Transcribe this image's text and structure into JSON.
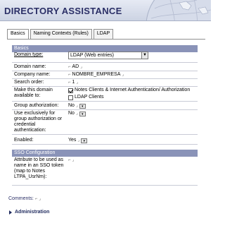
{
  "header": {
    "title": "DIRECTORY ASSISTANCE"
  },
  "tabs": [
    {
      "label": "Basics",
      "active": true
    },
    {
      "label": "Naming Contexts (Rules)",
      "active": false
    },
    {
      "label": "LDAP",
      "active": false
    }
  ],
  "basics": {
    "section_title": "Basics",
    "domain_type_label": "Domain type:",
    "domain_type_value": "LDAP (Web entries)",
    "domain_name_label": "Domain name:",
    "domain_name_value": "AD",
    "company_name_label": "Company name:",
    "company_name_value": "NOMBRE_EMPRESA",
    "search_order_label": "Search order:",
    "search_order_value": "1",
    "make_available_label": "Make this domain available to:",
    "option_notes_clients": "Notes Clients & Internet Authentication/ Authorization",
    "option_ldap_clients": "LDAP Clients",
    "group_auth_label": "Group authorization:",
    "group_auth_value": "No",
    "use_exclusively_label": "Use exclusively for group authorization or credential authentication:",
    "use_exclusively_value": "No",
    "enabled_label": "Enabled:",
    "enabled_value": "Yes"
  },
  "sso": {
    "section_title": "SSO Configuration",
    "attribute_label": "Attribute to be used as name in an SSO token (map to Notes LTPA_UsrNm):"
  },
  "footer": {
    "comments_label": "Comments:",
    "administration_label": "Administration"
  },
  "colors": {
    "header_title": "#2b2f66",
    "section_bar": "#8a93b8"
  }
}
